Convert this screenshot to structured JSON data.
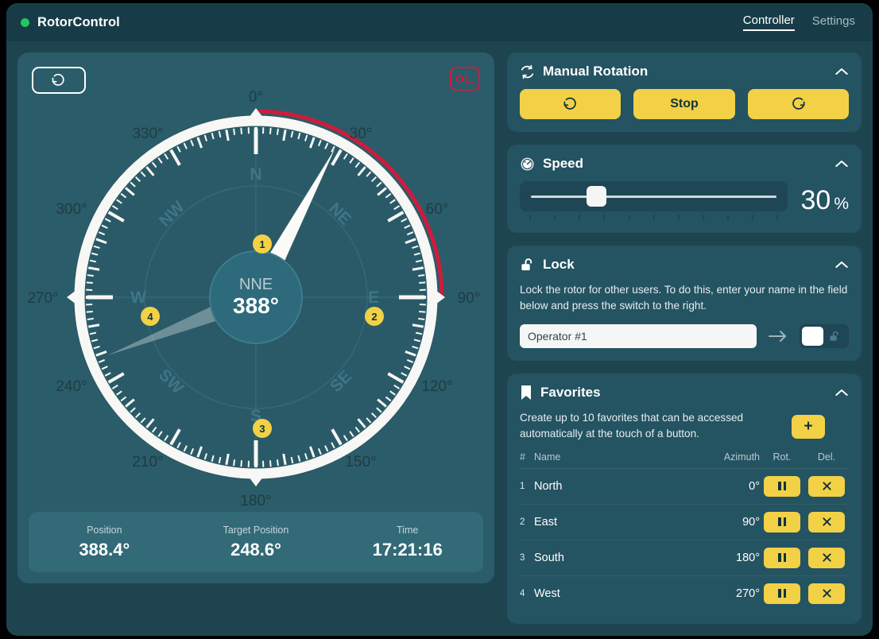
{
  "header": {
    "app_title": "RotorControl",
    "status_icon": "status-dot-online",
    "nav": [
      {
        "label": "Controller",
        "active": true
      },
      {
        "label": "Settings",
        "active": false
      }
    ]
  },
  "compass": {
    "reset_icon": "rotate-ccw-icon",
    "overlap_badge": "OL.",
    "center_direction": "NNE",
    "center_value": "388°",
    "heading_deg": 28,
    "target_deg": 248.6,
    "degree_labels": [
      "0°",
      "30°",
      "60°",
      "90°",
      "120°",
      "150°",
      "180°",
      "210°",
      "240°",
      "270°",
      "300°",
      "330°"
    ],
    "cardinals": [
      "N",
      "NE",
      "E",
      "SE",
      "S",
      "SW",
      "W",
      "NW"
    ],
    "markers": [
      {
        "id": "1",
        "angle": 0
      },
      {
        "id": "2",
        "angle": 90
      },
      {
        "id": "3",
        "angle": 180
      },
      {
        "id": "4",
        "angle": 270
      }
    ],
    "arc_color": "#d01b3c",
    "arc_start_deg": 0,
    "arc_end_deg": 90
  },
  "readout": [
    {
      "label": "Position",
      "value": "388.4°"
    },
    {
      "label": "Target Position",
      "value": "248.6°"
    },
    {
      "label": "Time",
      "value": "17:21:16"
    }
  ],
  "manual_rotation": {
    "icon": "rotate-sync-icon",
    "title": "Manual Rotation",
    "collapse_icon": "chevron-up-icon",
    "ccw_label": "",
    "ccw_icon": "rotate-ccw-icon",
    "stop_label": "Stop",
    "cw_label": "",
    "cw_icon": "rotate-cw-icon"
  },
  "speed": {
    "icon": "gauge-icon",
    "title": "Speed",
    "collapse_icon": "chevron-up-icon",
    "value": "30",
    "unit": "%",
    "percent": 30,
    "ticks": 11
  },
  "lock": {
    "icon": "unlock-icon",
    "title": "Lock",
    "collapse_icon": "chevron-up-icon",
    "description": "Lock the rotor for other users. To do this, enter your name in the field below and press the switch to the right.",
    "input_value": "Operator #1",
    "input_placeholder": "Operator #1",
    "arrow_icon": "arrow-right-icon",
    "toggle_state": "off",
    "toggle_icon": "unlock-icon"
  },
  "favorites": {
    "icon": "bookmark-icon",
    "title": "Favorites",
    "collapse_icon": "chevron-up-icon",
    "description": "Create up to 10 favorites that can be accessed automatically at the touch of a button.",
    "add_label": "+",
    "columns": [
      "#",
      "Name",
      "Azimuth",
      "Rot.",
      "Del."
    ],
    "rows": [
      {
        "num": "1",
        "name": "North",
        "azimuth": "0°",
        "rot_icon": "pause-icon",
        "del_icon": "close-icon"
      },
      {
        "num": "2",
        "name": "East",
        "azimuth": "90°",
        "rot_icon": "pause-icon",
        "del_icon": "close-icon"
      },
      {
        "num": "3",
        "name": "South",
        "azimuth": "180°",
        "rot_icon": "pause-icon",
        "del_icon": "close-icon"
      },
      {
        "num": "4",
        "name": "West",
        "azimuth": "270°",
        "rot_icon": "pause-icon",
        "del_icon": "close-icon"
      }
    ],
    "del_label": "×"
  },
  "colors": {
    "accent_yellow": "#f2d146",
    "danger_red": "#d01b3c",
    "online_green": "#22c55e",
    "panel_bg": "#245362",
    "card_bg": "#2b5c69",
    "window_bg": "#1e4450"
  }
}
